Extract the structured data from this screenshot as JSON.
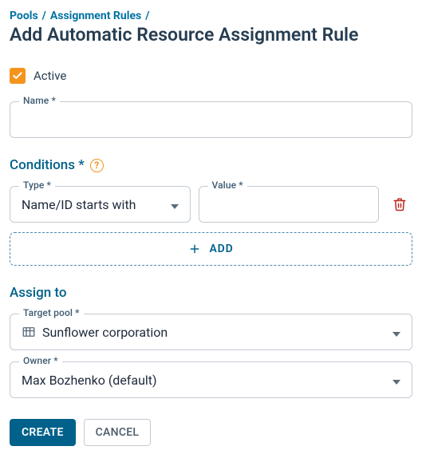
{
  "breadcrumb": [
    "Pools",
    "Assignment Rules"
  ],
  "page_title": "Add Automatic Resource Assignment Rule",
  "active": {
    "label": "Active",
    "checked": true
  },
  "name_field": {
    "label": "Name *",
    "value": ""
  },
  "sections": {
    "conditions_label": "Conditions *",
    "assign_to_label": "Assign to"
  },
  "conditions": [
    {
      "type_label": "Type *",
      "type_value": "Name/ID starts with",
      "value_label": "Value *",
      "value": ""
    }
  ],
  "add_button": "ADD",
  "target_pool": {
    "label": "Target pool *",
    "value": "Sunflower corporation"
  },
  "owner": {
    "label": "Owner *",
    "value": "Max Bozhenko (default)"
  },
  "buttons": {
    "create": "CREATE",
    "cancel": "CANCEL"
  },
  "colors": {
    "brand": "#00618a",
    "orange": "#f5941c",
    "danger": "#bd271e"
  }
}
